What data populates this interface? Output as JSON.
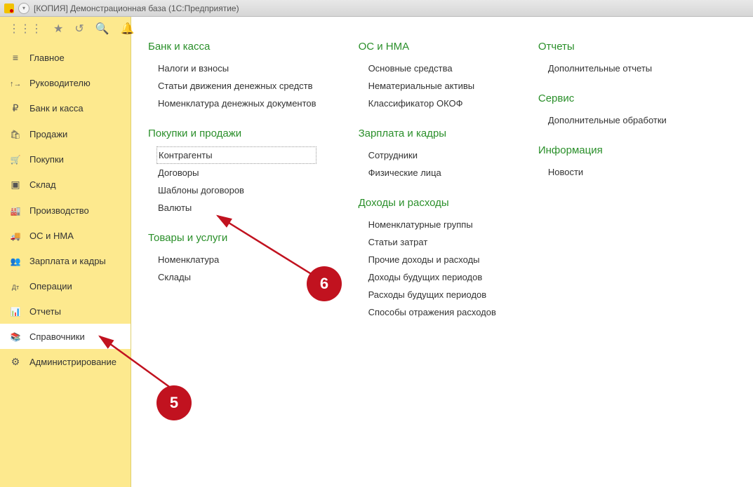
{
  "window": {
    "title": "[КОПИЯ] Демонстрационная база  (1С:Предприятие)"
  },
  "toolbar_icons": [
    "grid",
    "star",
    "history",
    "search",
    "bell"
  ],
  "nav": [
    {
      "icon": "hamburger",
      "label": "Главное"
    },
    {
      "icon": "chart",
      "label": "Руководителю"
    },
    {
      "icon": "ruble",
      "label": "Банк и касса"
    },
    {
      "icon": "bag",
      "label": "Продажи"
    },
    {
      "icon": "cart",
      "label": "Покупки"
    },
    {
      "icon": "warehouse",
      "label": "Склад"
    },
    {
      "icon": "factory",
      "label": "Производство"
    },
    {
      "icon": "truck",
      "label": "ОС и НМА"
    },
    {
      "icon": "people",
      "label": "Зарплата и кадры"
    },
    {
      "icon": "ops",
      "label": "Операции"
    },
    {
      "icon": "report",
      "label": "Отчеты"
    },
    {
      "icon": "books",
      "label": "Справочники",
      "active": true
    },
    {
      "icon": "gear",
      "label": "Администрирование"
    }
  ],
  "columns": [
    [
      {
        "title": "Банк и касса",
        "items": [
          "Налоги и взносы",
          "Статьи движения денежных средств",
          "Номенклатура денежных документов"
        ]
      },
      {
        "title": "Покупки и продажи",
        "items": [
          {
            "text": "Контрагенты",
            "selected": true
          },
          "Договоры",
          "Шаблоны договоров",
          "Валюты"
        ]
      },
      {
        "title": "Товары и услуги",
        "items": [
          "Номенклатура",
          "Склады"
        ]
      }
    ],
    [
      {
        "title": "ОС и НМА",
        "items": [
          "Основные средства",
          "Нематериальные активы",
          "Классификатор ОКОФ"
        ]
      },
      {
        "title": "Зарплата и кадры",
        "items": [
          "Сотрудники",
          "Физические лица"
        ]
      },
      {
        "title": "Доходы и расходы",
        "items": [
          "Номенклатурные группы",
          "Статьи затрат",
          "Прочие доходы и расходы",
          "Доходы будущих периодов",
          "Расходы будущих периодов",
          "Способы отражения расходов"
        ]
      }
    ],
    [
      {
        "title": "Отчеты",
        "items": [
          "Дополнительные отчеты"
        ]
      },
      {
        "title": "Сервис",
        "items": [
          "Дополнительные обработки"
        ]
      },
      {
        "title": "Информация",
        "items": [
          "Новости"
        ]
      }
    ]
  ],
  "badges": {
    "five": "5",
    "six": "6"
  }
}
